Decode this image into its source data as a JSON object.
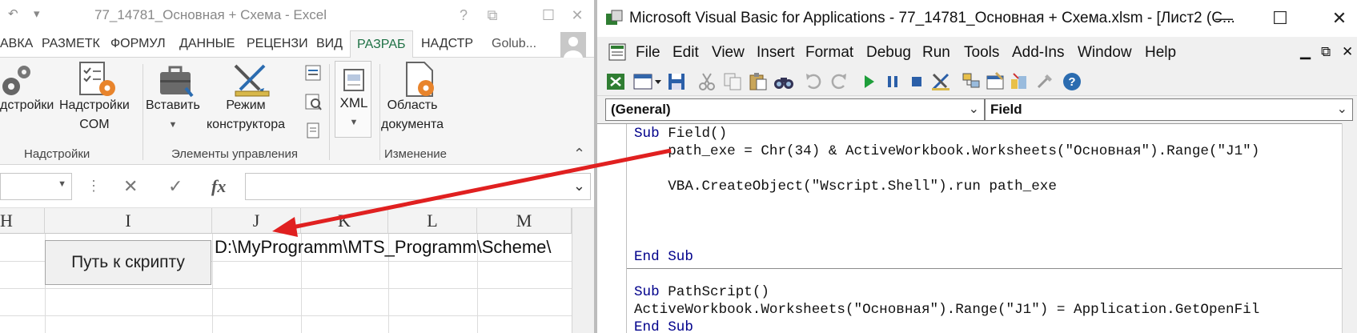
{
  "excel": {
    "title": "77_14781_Основная + Схема - Excel",
    "qat_undo": "↶",
    "qat_more": "▾",
    "window_help": "?",
    "window_restore": "⧉",
    "window_max": "☐",
    "window_close": "✕",
    "tabs": [
      "АВКА",
      "РАЗМЕТК",
      "ФОРМУЛ",
      "ДАННЫЕ",
      "РЕЦЕНЗИ",
      "ВИД",
      "РАЗРАБ",
      "НАДСТР"
    ],
    "active_tab": "РАЗРАБ",
    "user": "Golub...",
    "ribbon": {
      "addins_label": "дстройки",
      "com_addins_label_1": "Надстройки",
      "com_addins_label_2": "COM",
      "insert_label": "Вставить",
      "design_mode_label_1": "Режим",
      "design_mode_label_2": "конструктора",
      "xml_label": "XML",
      "doc_panel_label_1": "Область",
      "doc_panel_label_2": "документа",
      "group_addins": "Надстройки",
      "group_controls": "Элементы управления",
      "group_modify": "Изменение",
      "collapse": "⌃"
    },
    "formula_bar": {
      "namebox_value": "",
      "cancel": "✕",
      "enter": "✓",
      "fx": "fx",
      "formula_value": ""
    },
    "columns": [
      "H",
      "I",
      "J",
      "K",
      "L",
      "M"
    ],
    "sheet_button": "Путь к скрипту",
    "cell_j1": "D:\\MyProgramm\\MTS_Programm\\Scheme\\"
  },
  "vbe": {
    "title": "Microsoft Visual Basic for Applications - 77_14781_Основная + Схема.xlsm - [Лист2 (С...",
    "min": "—",
    "max": "☐",
    "close": "✕",
    "menu": [
      "File",
      "Edit",
      "View",
      "Insert",
      "Format",
      "Debug",
      "Run",
      "Tools",
      "Add-Ins",
      "Window",
      "Help"
    ],
    "mdi_min": "▁",
    "mdi_restore": "⧉",
    "mdi_close": "✕",
    "object_combo": "(General)",
    "proc_combo": "Field",
    "code": [
      "Sub Field()",
      "    path_exe = Chr(34) & ActiveWorkbook.Worksheets(\"Основная\").Range(\"J1\")",
      "",
      "    VBA.CreateObject(\"Wscript.Shell\").run path_exe",
      "",
      "",
      "",
      "End Sub",
      "",
      "Sub PathScript()",
      "ActiveWorkbook.Worksheets(\"Основная\").Range(\"J1\") = Application.GetOpenFil",
      "End Sub"
    ]
  },
  "colors": {
    "excel_green": "#1e7145",
    "arrow_red": "#e02020",
    "vba_keyword": "#00008b"
  }
}
